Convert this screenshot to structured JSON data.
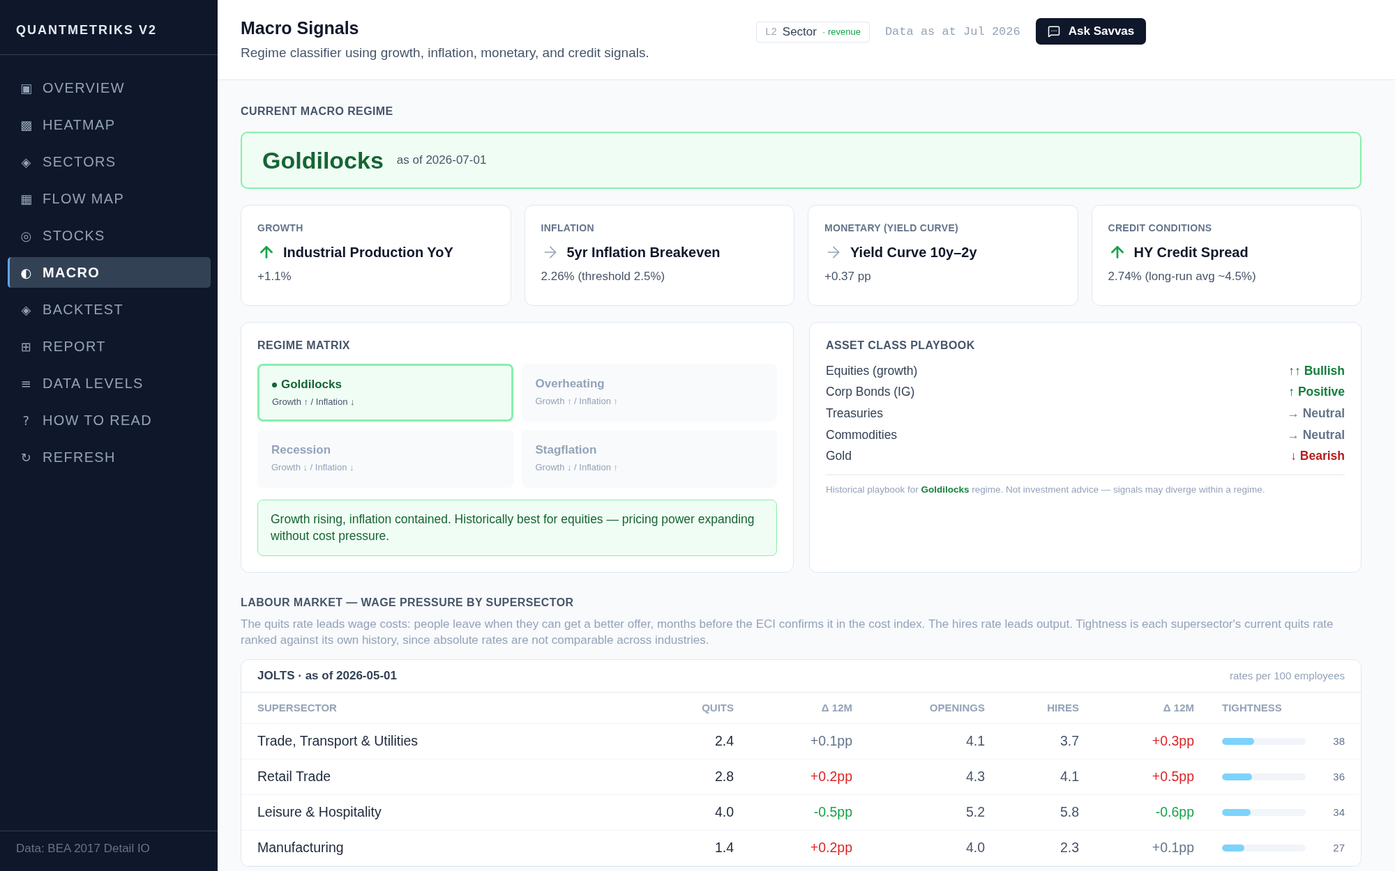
{
  "sidebar": {
    "brand": "QUANTMETRIKS V2",
    "items": [
      {
        "icon": "▣",
        "label": "OVERVIEW",
        "selected": false
      },
      {
        "icon": "▩",
        "label": "HEATMAP",
        "selected": false
      },
      {
        "icon": "◈",
        "label": "SECTORS",
        "selected": false
      },
      {
        "icon": "▦",
        "label": "FLOW MAP",
        "selected": false
      },
      {
        "icon": "◎",
        "label": "STOCKS",
        "selected": false
      },
      {
        "icon": "◐",
        "label": "MACRO",
        "selected": true
      },
      {
        "icon": "◈",
        "label": "BACKTEST",
        "selected": false
      },
      {
        "icon": "⊞",
        "label": "REPORT",
        "selected": false
      },
      {
        "icon": "≡",
        "label": "DATA LEVELS",
        "selected": false
      },
      {
        "icon": "?",
        "label": "HOW TO READ",
        "selected": false
      },
      {
        "icon": "↻",
        "label": "REFRESH",
        "selected": false
      }
    ],
    "footer": "Data: BEA 2017 Detail IO"
  },
  "header": {
    "title": "Macro Signals",
    "subtitle": "Regime classifier using growth, inflation, monetary, and credit signals.",
    "badge": {
      "level": "L2",
      "name": "Sector",
      "note": "· revenue"
    },
    "data_as_at": "Data as at Jul 2026",
    "ask_button": "Ask Savvas"
  },
  "regime": {
    "heading": "CURRENT MACRO REGIME",
    "name": "Goldilocks",
    "as_of": "as of 2026-07-01"
  },
  "signals": [
    {
      "category": "GROWTH",
      "kind": "up",
      "title": "Industrial Production YoY",
      "value": "+1.1%"
    },
    {
      "category": "INFLATION",
      "kind": "flat",
      "title": "5yr Inflation Breakeven",
      "value": "2.26% (threshold 2.5%)"
    },
    {
      "category": "MONETARY (YIELD CURVE)",
      "kind": "flat",
      "title": "Yield Curve 10y–2y",
      "value": "+0.37 pp"
    },
    {
      "category": "CREDIT CONDITIONS",
      "kind": "up",
      "title": "HY Credit Spread",
      "value": "2.74% (long-run avg ~4.5%)"
    }
  ],
  "matrix": {
    "heading": "REGIME MATRIX",
    "cells": [
      {
        "name": "Goldilocks",
        "condition": "Growth ↑ / Inflation ↓",
        "selected": true
      },
      {
        "name": "Overheating",
        "condition": "Growth ↑ / Inflation ↑",
        "selected": false
      },
      {
        "name": "Recession",
        "condition": "Growth ↓ / Inflation ↓",
        "selected": false
      },
      {
        "name": "Stagflation",
        "condition": "Growth ↓ / Inflation ↑",
        "selected": false
      }
    ],
    "description": "Growth rising, inflation contained. Historically best for equities — pricing power expanding without cost pressure."
  },
  "playbook": {
    "heading": "ASSET CLASS PLAYBOOK",
    "rows": [
      {
        "asset": "Equities (growth)",
        "outlook": "↑↑ Bullish",
        "color": "#15803d"
      },
      {
        "asset": "Corp Bonds (IG)",
        "outlook": "↑ Positive",
        "color": "#15803d"
      },
      {
        "asset": "Treasuries",
        "outlook": "→ Neutral",
        "color": "#64748b"
      },
      {
        "asset": "Commodities",
        "outlook": "→ Neutral",
        "color": "#64748b"
      },
      {
        "asset": "Gold",
        "outlook": "↓ Bearish",
        "color": "#b91c1c"
      }
    ],
    "note": "Historical playbook for **Goldilocks** regime. Not investment advice — signals may diverge within a regime."
  },
  "labour": {
    "heading": "LABOUR MARKET — WAGE PRESSURE BY SUPERSECTOR",
    "description": "The quits rate leads wage costs: people leave when they can get a better offer, months before the ECI confirms it in the cost index. The hires rate leads output. Tightness is each supersector's current quits rate ranked against its own history, since absolute rates are not comparable across industries.",
    "table": {
      "title": "JOLTS · as of 2026-05-01",
      "unit": "rates per 100 employees",
      "columns": [
        "SUPERSECTOR",
        "QUITS",
        "Δ 12M",
        "OPENINGS",
        "HIRES",
        "Δ 12M",
        "TIGHTNESS"
      ],
      "rows": [
        {
          "supersector": "Trade, Transport & Utilities",
          "quits": "2.4",
          "quits_change": {
            "text": "+0.1pp",
            "color": "#64748b"
          },
          "openings": "4.1",
          "hires": "3.7",
          "hires_change": {
            "text": "+0.3pp",
            "color": "#dc2626"
          },
          "tightness": {
            "level": 0.38,
            "reading": "38"
          }
        },
        {
          "supersector": "Retail Trade",
          "quits": "2.8",
          "quits_change": {
            "text": "+0.2pp",
            "color": "#dc2626"
          },
          "openings": "4.3",
          "hires": "4.1",
          "hires_change": {
            "text": "+0.5pp",
            "color": "#dc2626"
          },
          "tightness": {
            "level": 0.36,
            "reading": "36"
          }
        },
        {
          "supersector": "Leisure & Hospitality",
          "quits": "4.0",
          "quits_change": {
            "text": "-0.5pp",
            "color": "#16a34a"
          },
          "openings": "5.2",
          "hires": "5.8",
          "hires_change": {
            "text": "-0.6pp",
            "color": "#16a34a"
          },
          "tightness": {
            "level": 0.34,
            "reading": "34"
          }
        },
        {
          "supersector": "Manufacturing",
          "quits": "1.4",
          "quits_change": {
            "text": "+0.2pp",
            "color": "#dc2626"
          },
          "openings": "4.0",
          "hires": "2.3",
          "hires_change": {
            "text": "+0.1pp",
            "color": "#64748b"
          },
          "tightness": {
            "level": 0.27,
            "reading": "27"
          }
        }
      ]
    }
  }
}
